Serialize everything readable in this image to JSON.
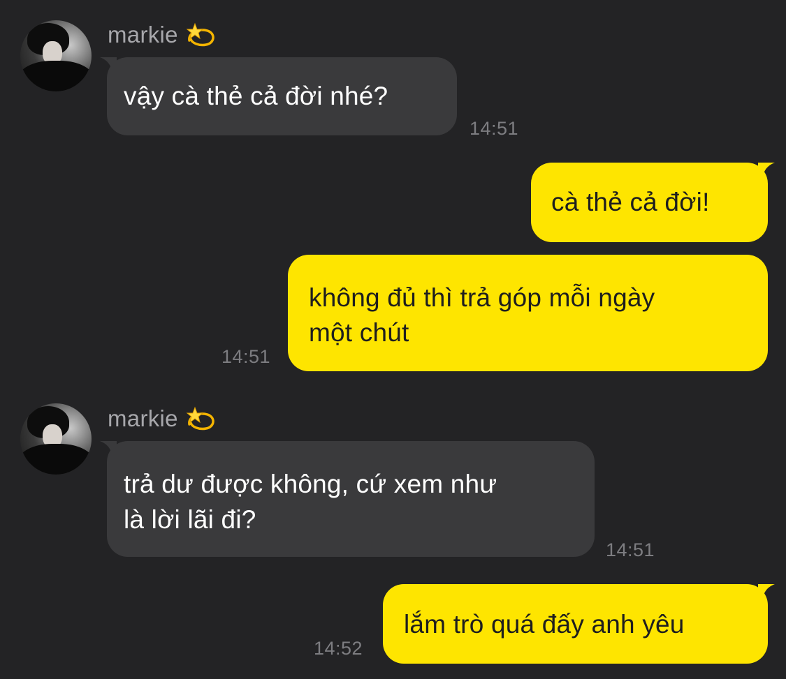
{
  "colors": {
    "background": "#232325",
    "incoming_bubble": "#3a3a3c",
    "outgoing_bubble": "#fee500",
    "timestamp": "#7d7d81",
    "sender_name": "#a7a7ab"
  },
  "messages": [
    {
      "direction": "incoming",
      "sender": "markie",
      "sender_icon": "dizzy-star-icon",
      "text": "vậy cà thẻ cả đời nhé?",
      "time": "14:51"
    },
    {
      "direction": "outgoing",
      "text": "cà thẻ cả đời!"
    },
    {
      "direction": "outgoing",
      "text_line1": "không đủ thì trả góp mỗi ngày",
      "text_line2": "một chút",
      "time": "14:51"
    },
    {
      "direction": "incoming",
      "sender": "markie",
      "sender_icon": "dizzy-star-icon",
      "text_line1": "trả dư được không, cứ xem như",
      "text_line2": "là lời lãi đi?",
      "time": "14:51"
    },
    {
      "direction": "outgoing",
      "text": "lắm trò quá đấy anh yêu",
      "time": "14:52"
    }
  ]
}
